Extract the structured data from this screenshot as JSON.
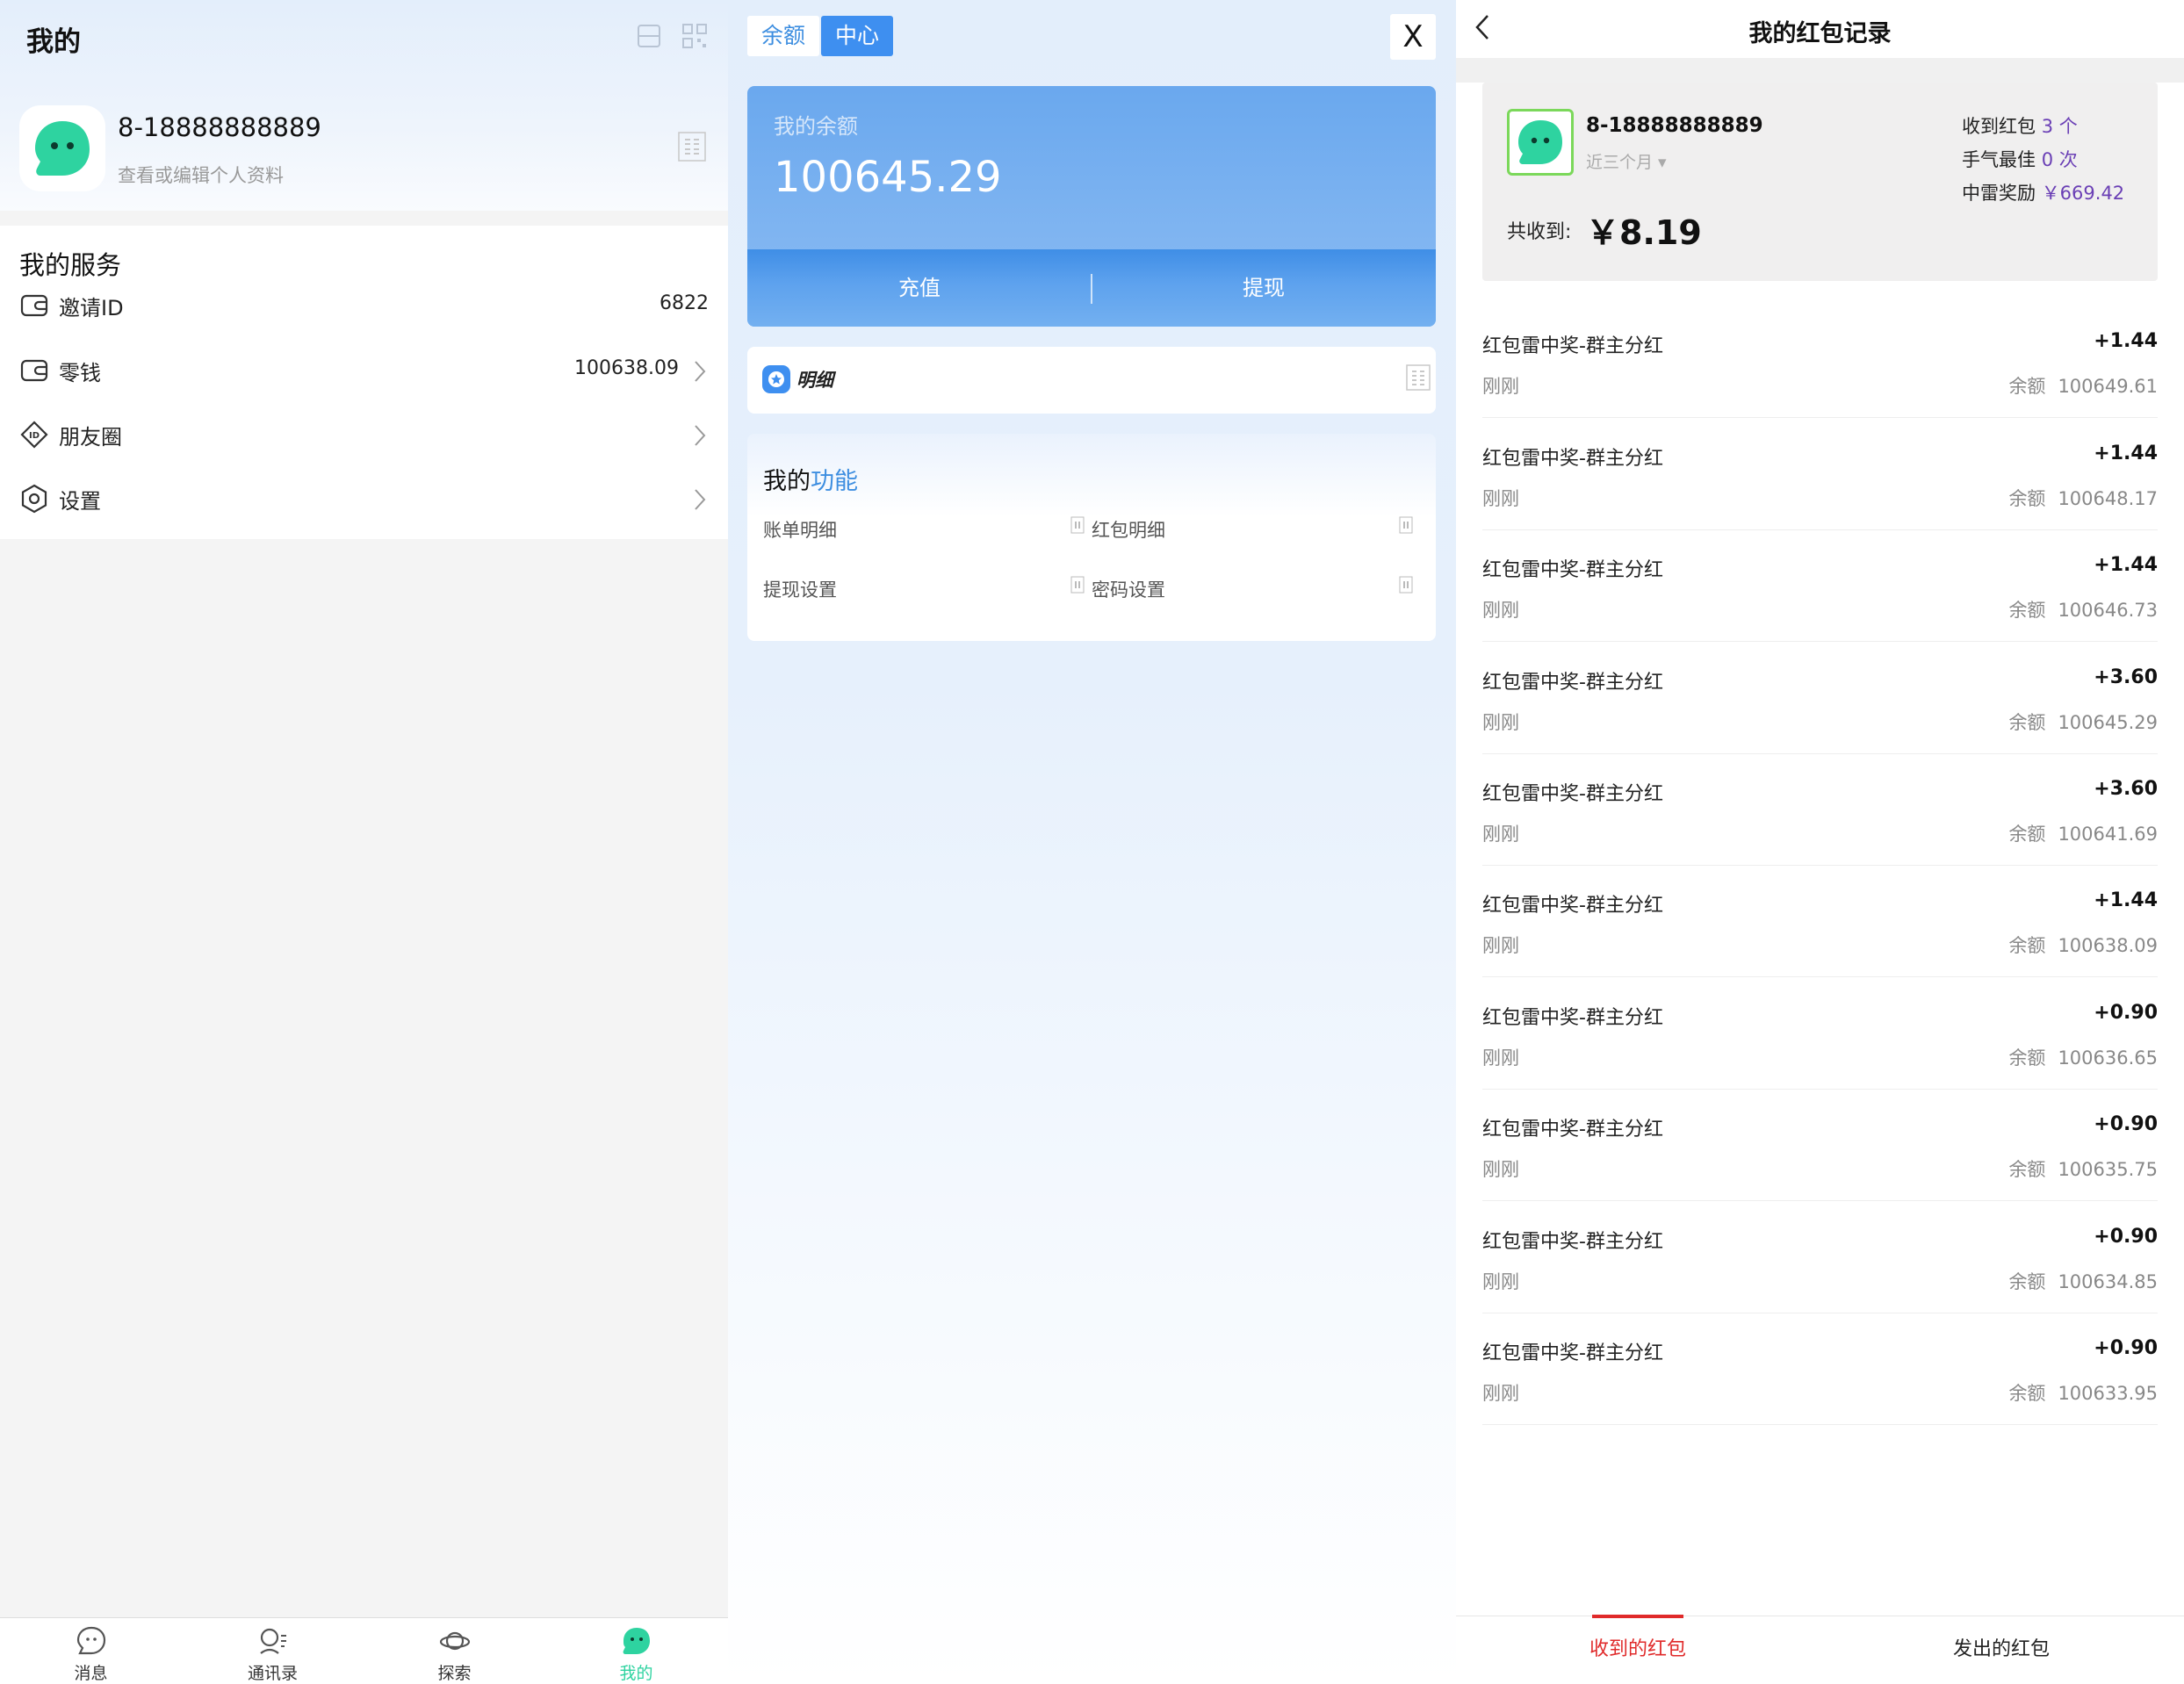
{
  "colors": {
    "accent_blue": "#3e8ff0",
    "brand_green": "#2ed3a0",
    "active_red": "#e02a2a",
    "purple": "#6a3fb5"
  },
  "me": {
    "title": "我的",
    "user": {
      "name": "8-18888888889",
      "subtitle": "查看或编辑个人资料"
    },
    "services_title": "我的服务",
    "services": [
      {
        "label": "邀请ID",
        "value": "6822",
        "icon": "wallet-icon"
      },
      {
        "label": "零钱",
        "value": "100638.09",
        "icon": "wallet-icon"
      },
      {
        "label": "朋友圈",
        "value": "",
        "icon": "diamond-id-icon"
      },
      {
        "label": "设置",
        "value": "",
        "icon": "hexagon-settings-icon"
      }
    ],
    "tabs": [
      {
        "label": "消息",
        "icon": "chat-bubble-icon"
      },
      {
        "label": "通讯录",
        "icon": "contacts-icon"
      },
      {
        "label": "探索",
        "icon": "planet-icon"
      },
      {
        "label": "我的",
        "icon": "mascot-icon"
      }
    ]
  },
  "wallet": {
    "switch": {
      "balance": "余额",
      "center": "中心"
    },
    "close": "X",
    "balance_label": "我的余额",
    "balance_value": "100645.29",
    "recharge": "充值",
    "withdraw": "提现",
    "detail": "明细",
    "func_title_a": "我的",
    "func_title_b": "功能",
    "functions": [
      "账单明细",
      "红包明细",
      "提现设置",
      "密码设置"
    ]
  },
  "records": {
    "title": "我的红包记录",
    "user": "8-18888888889",
    "period": "近三个月 ▾",
    "total_label": "共收到:",
    "total": "￥8.19",
    "stats": [
      {
        "label": "收到红包",
        "value": "3 个"
      },
      {
        "label": "手气最佳",
        "value": "0 次"
      },
      {
        "label": "中雷奖励",
        "value": "￥669.42"
      }
    ],
    "balance_label": "余额",
    "items": [
      {
        "title": "红包雷中奖-群主分红",
        "amount": "+1.44",
        "time": "刚刚",
        "balance": "100649.61"
      },
      {
        "title": "红包雷中奖-群主分红",
        "amount": "+1.44",
        "time": "刚刚",
        "balance": "100648.17"
      },
      {
        "title": "红包雷中奖-群主分红",
        "amount": "+1.44",
        "time": "刚刚",
        "balance": "100646.73"
      },
      {
        "title": "红包雷中奖-群主分红",
        "amount": "+3.60",
        "time": "刚刚",
        "balance": "100645.29"
      },
      {
        "title": "红包雷中奖-群主分红",
        "amount": "+3.60",
        "time": "刚刚",
        "balance": "100641.69"
      },
      {
        "title": "红包雷中奖-群主分红",
        "amount": "+1.44",
        "time": "刚刚",
        "balance": "100638.09"
      },
      {
        "title": "红包雷中奖-群主分红",
        "amount": "+0.90",
        "time": "刚刚",
        "balance": "100636.65"
      },
      {
        "title": "红包雷中奖-群主分红",
        "amount": "+0.90",
        "time": "刚刚",
        "balance": "100635.75"
      },
      {
        "title": "红包雷中奖-群主分红",
        "amount": "+0.90",
        "time": "刚刚",
        "balance": "100634.85"
      },
      {
        "title": "红包雷中奖-群主分红",
        "amount": "+0.90",
        "time": "刚刚",
        "balance": "100633.95"
      }
    ],
    "tabs": {
      "received": "收到的红包",
      "sent": "发出的红包"
    }
  }
}
